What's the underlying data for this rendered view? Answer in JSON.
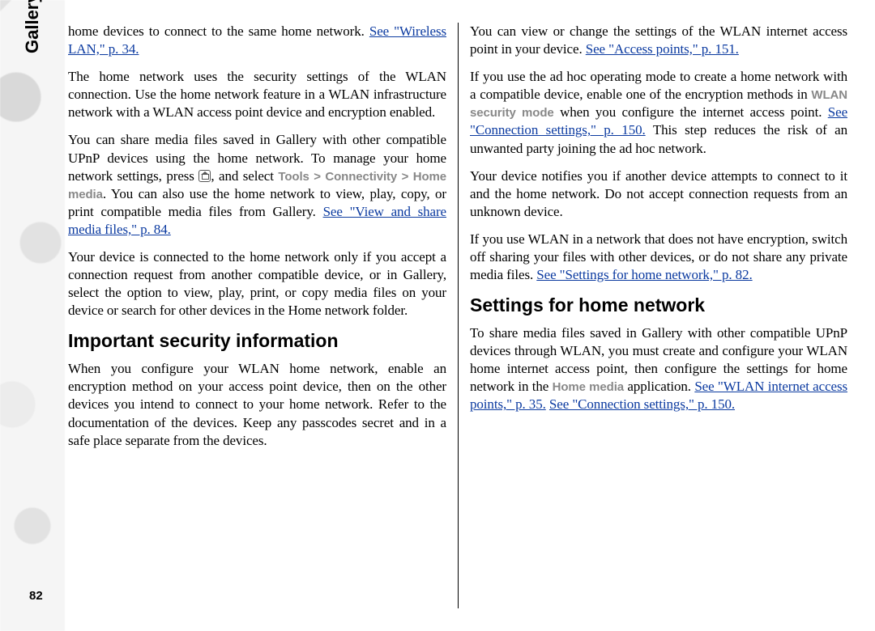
{
  "sideLabel": "Gallery",
  "pageNumber": "82",
  "left": {
    "p1_a": "home devices to connect to the same home network. ",
    "p1_link": "See \"Wireless LAN,\" p. 34.",
    "p2": "The home network uses the security settings of the WLAN connection. Use the home network feature in a WLAN infrastructure network with a WLAN access point device and encryption enabled.",
    "p3_a": "You can share media files saved in Gallery with other compatible UPnP devices using the home network. To manage your home network settings, press ",
    "p3_b": ", and select ",
    "p3_path1": "Tools",
    "p3_sep": " > ",
    "p3_path2": "Connectivity",
    "p3_path3": "Home media",
    "p3_c": ". You can also use the home network to view, play, copy, or print compatible media files from Gallery. ",
    "p3_link": "See \"View and share media files,\" p. 84.",
    "p4": "Your device is connected to the home network only if you accept a connection request from another compatible device, or in Gallery, select the option to view, play, print, or copy media files on your device or search for other devices in the Home network folder.",
    "h2": "Important security information",
    "p5": "When you configure your WLAN home network, enable an encryption method on your access point device, then on the other devices you intend to connect to your home network. Refer to the documentation of the devices. Keep any passcodes secret and in a safe place separate from the devices."
  },
  "right": {
    "p1_a": "You can view or change the settings of the WLAN internet access point in your device. ",
    "p1_link": "See \"Access points,\" p. 151.",
    "p2_a": "If you use the ad hoc operating mode to create a home network with a compatible device, enable one of the encryption methods in ",
    "p2_bold": "WLAN security mode",
    "p2_b": " when you configure the internet access point. ",
    "p2_link": "See \"Connection settings,\" p. 150.",
    "p2_c": " This step reduces the risk of an unwanted party joining the ad hoc network.",
    "p3": "Your device notifies you if another device attempts to connect to it and the home network. Do not accept connection requests from an unknown device.",
    "p4_a": "If you use WLAN in a network that does not have encryption, switch off sharing your files with other devices, or do not share any private media files. ",
    "p4_link": "See \"Settings for home network,\" p. 82.",
    "h2": "Settings for home network",
    "p5_a": "To share media files saved in Gallery with other compatible UPnP devices through WLAN, you must create and configure your WLAN home internet access point, then configure the settings for home network in the ",
    "p5_bold": "Home media",
    "p5_b": " application. ",
    "p5_link1": "See \"WLAN internet access points,\" p. 35.",
    "p5_sep": " ",
    "p5_link2": "See \"Connection settings,\" p. 150."
  }
}
